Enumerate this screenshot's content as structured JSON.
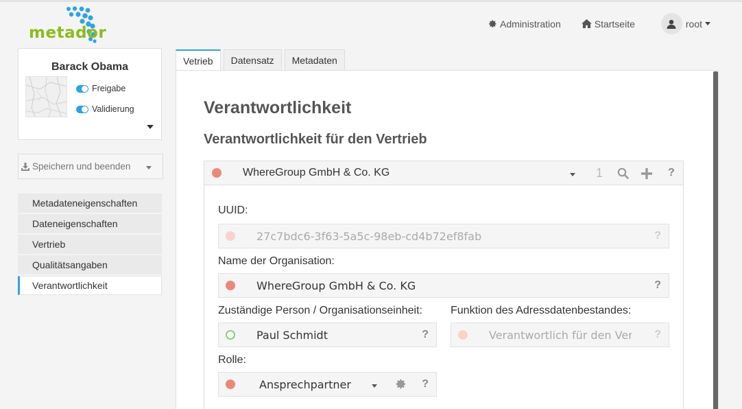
{
  "header": {
    "logo_text": "metador",
    "admin_label": "Administration",
    "home_label": "Startseite",
    "user_label": "root"
  },
  "profile": {
    "name": "Barack Obama",
    "toggle1_label": "Freigabe",
    "toggle2_label": "Validierung"
  },
  "save": {
    "label": "Speichern und beenden"
  },
  "sidenav": {
    "items": [
      {
        "label": "Metadateneigenschaften"
      },
      {
        "label": "Dateneigenschaften"
      },
      {
        "label": "Vertrieb"
      },
      {
        "label": "Qualitätsangaben"
      },
      {
        "label": "Verantwortlichkeit"
      }
    ]
  },
  "tabs": [
    {
      "label": "Vetrieb"
    },
    {
      "label": "Datensatz"
    },
    {
      "label": "Metadaten"
    }
  ],
  "main": {
    "title": "Verantwortlichkeit",
    "subtitle": "Verantwortlichkeit für den Vertrieb",
    "fieldset": {
      "header_value": "WhereGroup GmbH & Co. KG",
      "count": "1",
      "help": "?"
    },
    "uuid": {
      "label": "UUID:",
      "value": "27c7bdc6-3f63-5a5c-98eb-cd4b72ef8fab"
    },
    "org": {
      "label": "Name der Organisation:",
      "value": "WhereGroup GmbH & Co. KG"
    },
    "person": {
      "label": "Zuständige Person / Organisationseinheit:",
      "value": "Paul Schmidt"
    },
    "function": {
      "label": "Funktion des Adressdatenbestandes:",
      "value": "Verantwortlich für den Vertrieb"
    },
    "role": {
      "label": "Rolle:",
      "value": "Ansprechpartner"
    }
  },
  "colors": {
    "accent": "#2ea3e0",
    "logo_green": "#8dbb1c",
    "status_red": "#e9897a",
    "status_green": "#8ad27a"
  }
}
